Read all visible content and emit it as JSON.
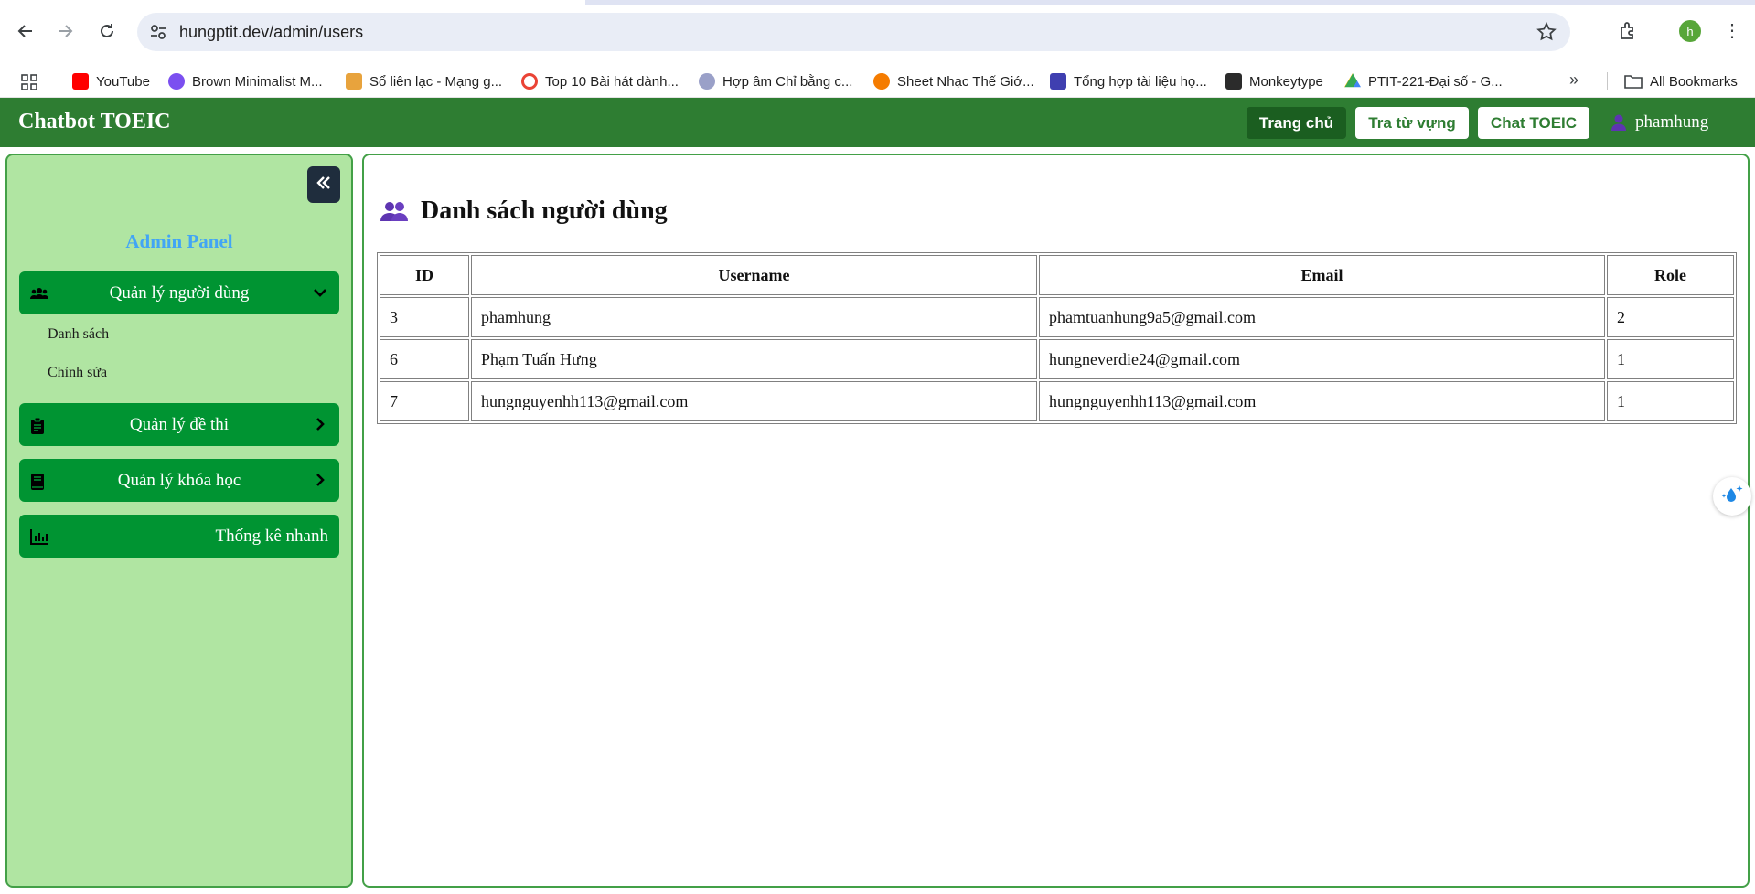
{
  "browser": {
    "url": "hungptit.dev/admin/users",
    "profile_initial": "h",
    "bookmarks": [
      {
        "label": "YouTube",
        "color": "#ff0000"
      },
      {
        "label": "Brown Minimalist M...",
        "color": "#7b4ff0"
      },
      {
        "label": "Sổ liên lạc - Mạng g...",
        "color": "#e8a33d"
      },
      {
        "label": "Top 10 Bài hát dành...",
        "color": "#ea4335"
      },
      {
        "label": "Hợp âm Chỉ bằng c...",
        "color": "#9aa0c8"
      },
      {
        "label": "Sheet Nhạc Thế Giớ...",
        "color": "#f57c00"
      },
      {
        "label": "Tổng hợp tài liệu họ...",
        "color": "#3f3fb0"
      },
      {
        "label": "Monkeytype",
        "color": "#2b2b2b"
      },
      {
        "label": "PTIT-221-Đại số - G...",
        "color": "#34a853"
      }
    ],
    "all_bookmarks_label": "All Bookmarks"
  },
  "header": {
    "brand": "Chatbot TOEIC",
    "home_label": "Trang chủ",
    "vocab_label": "Tra từ vựng",
    "chat_label": "Chat TOEIC",
    "username": "phamhung"
  },
  "sidebar": {
    "title": "Admin Panel",
    "menu": [
      {
        "label": "Quản lý người dùng",
        "icon": "users-icon"
      },
      {
        "label": "Quản lý đề thi",
        "icon": "clipboard-icon"
      },
      {
        "label": "Quản lý khóa học",
        "icon": "book-icon"
      },
      {
        "label": "Thống kê nhanh",
        "icon": "chart-icon"
      }
    ],
    "submenu": [
      "Danh sách",
      "Chỉnh sửa"
    ]
  },
  "main": {
    "title": "Danh sách người dùng",
    "columns": [
      "ID",
      "Username",
      "Email",
      "Role"
    ],
    "rows": [
      [
        "3",
        "phamhung",
        "phamtuanhung9a5@gmail.com",
        "2"
      ],
      [
        "6",
        "Phạm Tuấn Hưng",
        "hungneverdie24@gmail.com",
        "1"
      ],
      [
        "7",
        "hungnguyenhh113@gmail.com",
        "hungnguyenhh113@gmail.com",
        "1"
      ]
    ]
  },
  "colors": {
    "header_green": "#2e7d32",
    "sidebar_bg": "#b0e5a2",
    "menu_green": "#009432",
    "panel_title_blue": "#42a5f5"
  }
}
